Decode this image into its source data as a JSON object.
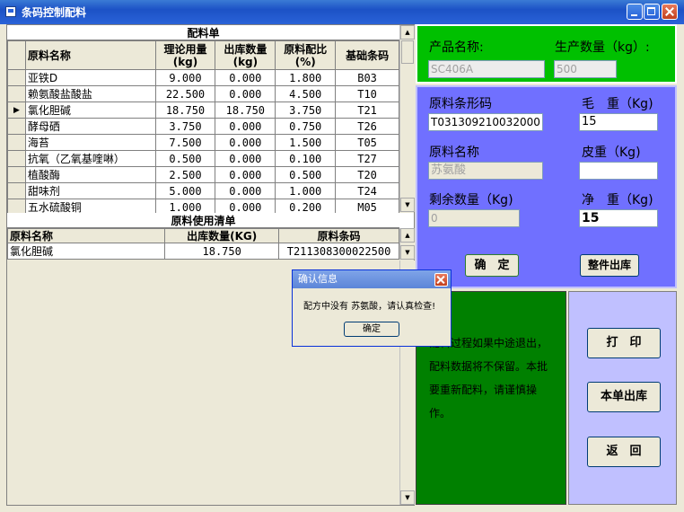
{
  "window": {
    "title": "条码控制配料"
  },
  "recipe": {
    "title": "配料单",
    "headers": [
      "原料名称",
      "理论用量\n(kg)",
      "出库数量\n(kg)",
      "原料配比\n(%)",
      "基础条码"
    ],
    "rows": [
      {
        "name": "亚铁D",
        "theory": "9.000",
        "out": "0.000",
        "ratio": "1.800",
        "code": "B03"
      },
      {
        "name": "赖氨酸盐酸盐",
        "theory": "22.500",
        "out": "0.000",
        "ratio": "4.500",
        "code": "T10"
      },
      {
        "name": "氯化胆碱",
        "theory": "18.750",
        "out": "18.750",
        "ratio": "3.750",
        "code": "T21"
      },
      {
        "name": "酵母硒",
        "theory": "3.750",
        "out": "0.000",
        "ratio": "0.750",
        "code": "T26"
      },
      {
        "name": "海苔",
        "theory": "7.500",
        "out": "0.000",
        "ratio": "1.500",
        "code": "T05"
      },
      {
        "name": "抗氧（乙氧基喹啉）",
        "theory": "0.500",
        "out": "0.000",
        "ratio": "0.100",
        "code": "T27"
      },
      {
        "name": "植酸酶",
        "theory": "2.500",
        "out": "0.000",
        "ratio": "0.500",
        "code": "T20"
      },
      {
        "name": "甜味剂",
        "theory": "5.000",
        "out": "0.000",
        "ratio": "1.000",
        "code": "T24"
      },
      {
        "name": "五水硫酸铜",
        "theory": "1.000",
        "out": "0.000",
        "ratio": "0.200",
        "code": "M05"
      }
    ],
    "current_row_marker": "▶"
  },
  "usage": {
    "title": "原料使用清单",
    "headers": [
      "原料名称",
      "出库数量(KG)",
      "原料条码"
    ],
    "rows": [
      {
        "name": "氯化胆碱",
        "qty": "18.750",
        "code": "T211308300022500"
      }
    ]
  },
  "product": {
    "name_label": "产品名称:",
    "qty_label": "生产数量（kg）:",
    "name_value": "SC406A",
    "qty_value": "500"
  },
  "material": {
    "barcode_label": "原料条形码",
    "barcode_value": "T031309210032000",
    "gross_label": "毛　重（Kg)",
    "gross_value": "15",
    "name_label": "原料名称",
    "name_value": "苏氨酸",
    "tare_label": "皮重（Kg)",
    "tare_value": "",
    "remain_label": "剩余数量（Kg)",
    "remain_value": "0",
    "net_label": "净　重（Kg)",
    "net_value": "15",
    "confirm_label": "确　定",
    "whole_out_label": "整件出库"
  },
  "notice": {
    "text": "配料过程如果中途退出，配料数据将不保留。本批要重新配料，请谨慎操作。"
  },
  "actions": {
    "print_label": "打　印",
    "single_out_label": "本单出库",
    "back_label": "返　回"
  },
  "dialog": {
    "title": "确认信息",
    "message": "配方中没有 苏氨酸，请认真检查!",
    "ok_label": "确定"
  },
  "colors": {
    "product_panel": "#00c000",
    "material_panel": "#7070ff",
    "notice_panel": "#008000",
    "action_panel": "#c0c0ff"
  }
}
